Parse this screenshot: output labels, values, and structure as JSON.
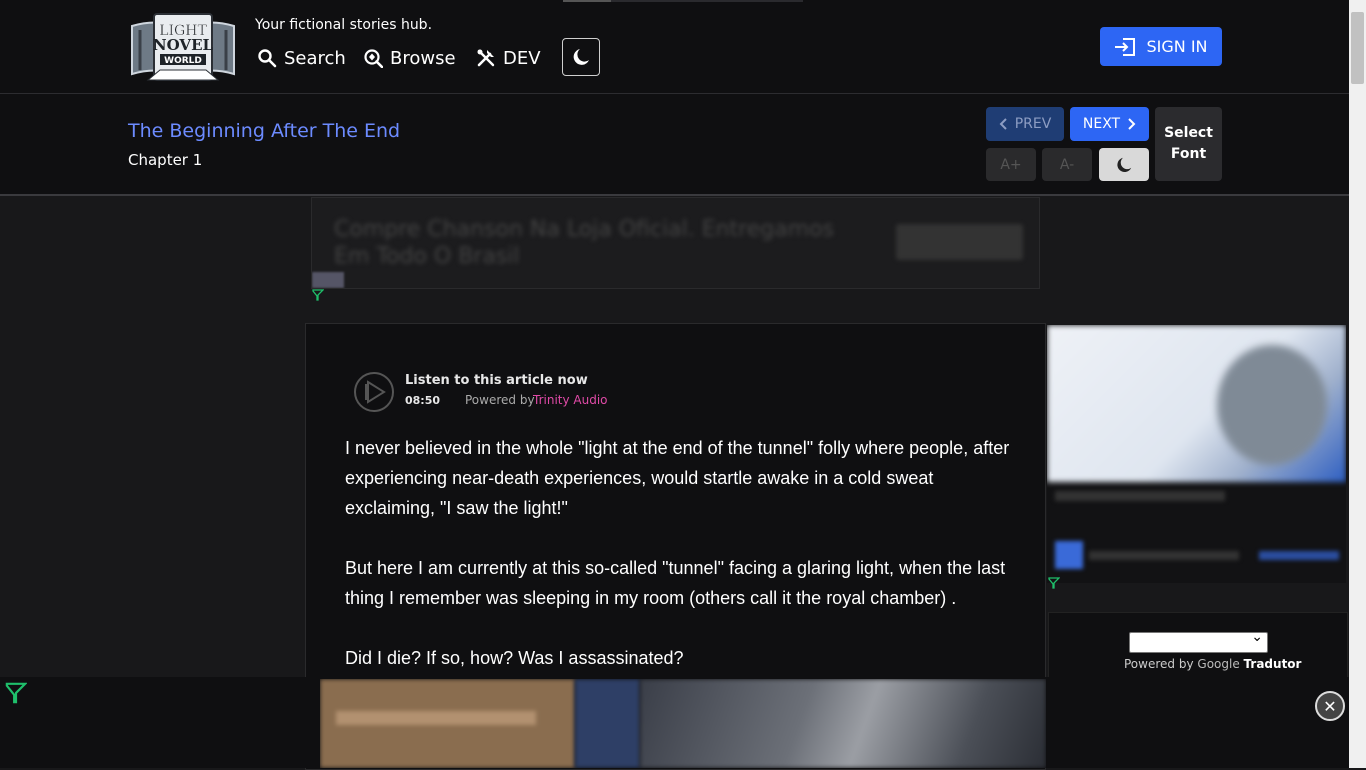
{
  "header": {
    "tagline": "Your fictional stories hub.",
    "logo": {
      "line1": "LIGHT",
      "line2": "NOVEL",
      "line3": "WORLD"
    },
    "nav": [
      {
        "label": "Search",
        "icon": "search-icon"
      },
      {
        "label": "Browse",
        "icon": "browse-icon"
      },
      {
        "label": "DEV",
        "icon": "tools-icon"
      }
    ],
    "signin_label": "SIGN IN"
  },
  "chapter": {
    "novel_title": "The Beginning After The End",
    "chapter_label": "Chapter 1",
    "prev_label": "PREV",
    "next_label": "NEXT",
    "font_inc_label": "A+",
    "font_dec_label": "A-",
    "select_font_line1": "Select",
    "select_font_line2": "Font"
  },
  "audio": {
    "title": "Listen to this article now",
    "duration": "08:50",
    "powered_label": "Powered by",
    "brand": "Trinity Audio"
  },
  "article": {
    "paragraphs": [
      "I never believed in the whole \"light at the end of the tunnel\" folly where people, after experiencing near-death experiences, would startle awake in a cold sweat exclaiming, \"I saw the light!\"",
      "But here I am currently at this so-called \"tunnel\" facing a glaring light, when the last thing I remember was sleeping in my room (others call it the royal chamber) .",
      "Did I die? If so, how? Was I assassinated?"
    ]
  },
  "translate": {
    "powered_label": "Powered by",
    "google_label": "Google",
    "tradutor_label": "Tradutor"
  },
  "colors": {
    "accent": "#2d66f4",
    "title_link": "#6c8bff",
    "trinity_brand": "#e04aa7",
    "background": "#18181a",
    "panel": "#0f0f11"
  }
}
